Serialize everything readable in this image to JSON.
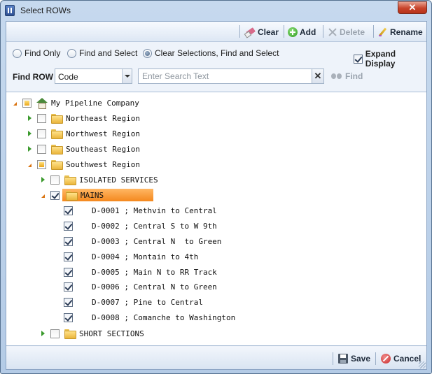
{
  "window": {
    "title": "Select ROWs",
    "close_label": "✕"
  },
  "toolbar": {
    "clear_label": "Clear",
    "add_label": "Add",
    "delete_label": "Delete",
    "rename_label": "Rename"
  },
  "options": {
    "find_only_label": "Find Only",
    "find_and_select_label": "Find and Select",
    "clear_find_select_label": "Clear Selections, Find and Select",
    "selected_mode": "Clear Selections, Find and Select",
    "expand_display_label": "Expand Display",
    "expand_display_checked": true
  },
  "find_row": {
    "label": "Find ROW",
    "field_value": "Code",
    "search_placeholder": "Enter Search Text",
    "clear_label": "✕",
    "find_label": "Find"
  },
  "tree": {
    "root": "My Pipeline Company",
    "regions": [
      "Northeast Region",
      "Northwest Region",
      "Southeast Region",
      "Southwest Region"
    ],
    "southwest_children": [
      "ISOLATED SERVICES",
      "MAINS",
      "SHORT SECTIONS"
    ],
    "mains_items": [
      "D-0001 ; Methvin to Central",
      "D-0002 ; Central S to W 9th",
      "D-0003 ; Central N  to Green",
      "D-0004 ; Montain to 4th",
      "D-0005 ; Main N to RR Track",
      "D-0006 ; Central N to Green",
      "D-0007 ; Pine to Central",
      "D-0008 ; Comanche to Washington"
    ]
  },
  "footer": {
    "save_label": "Save",
    "cancel_label": "Cancel"
  }
}
